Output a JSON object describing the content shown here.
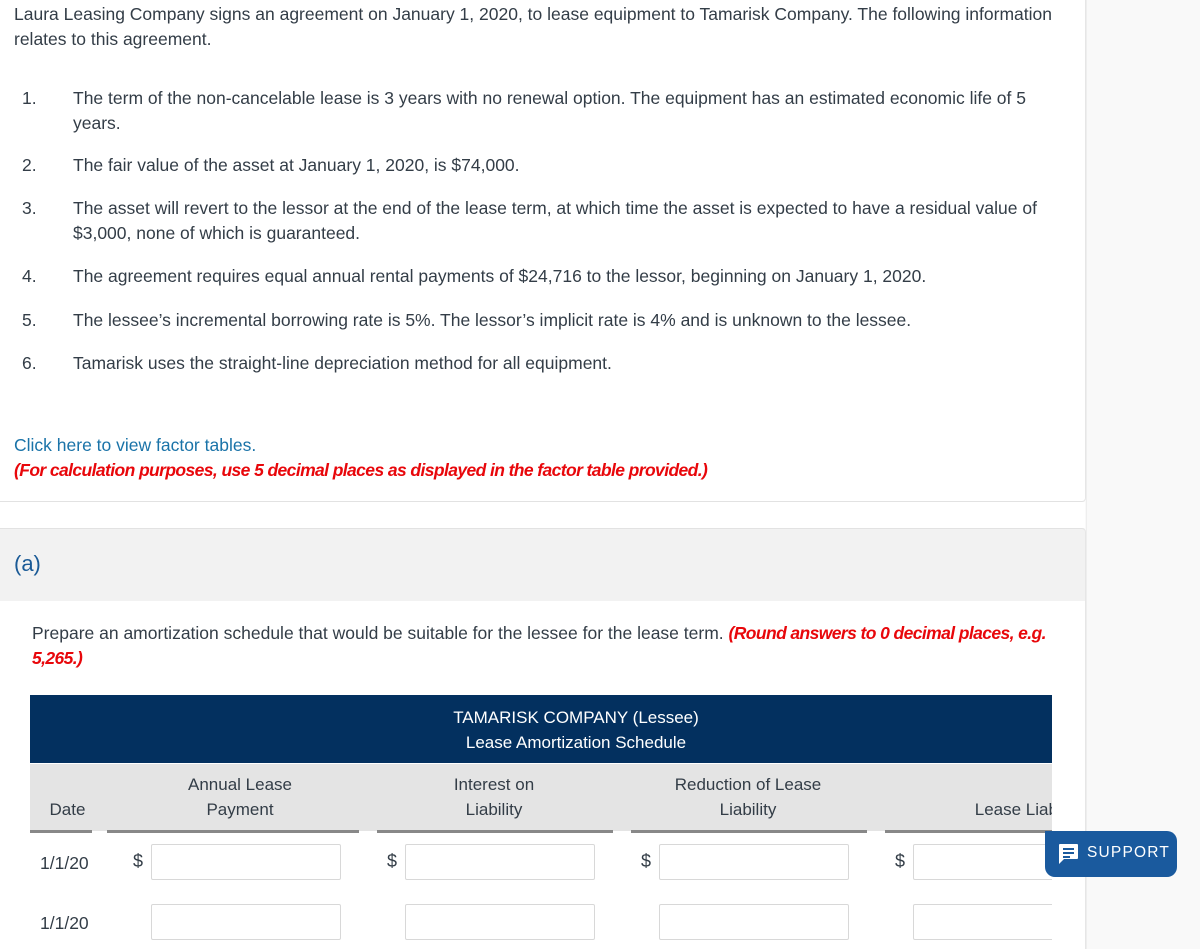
{
  "problem": {
    "intro": "Laura Leasing Company signs an agreement on January 1, 2020, to lease equipment to Tamarisk Company. The following information relates to this agreement.",
    "items": [
      {
        "num": "1.",
        "text": "The term of the non-cancelable lease is 3 years with no renewal option. The equipment has an estimated economic life of 5 years."
      },
      {
        "num": "2.",
        "text": "The fair value of the asset at January 1, 2020, is $74,000."
      },
      {
        "num": "3.",
        "text": "The asset will revert to the lessor at the end of the lease term, at which time the asset is expected to have a residual value of $3,000, none of which is guaranteed."
      },
      {
        "num": "4.",
        "text": "The agreement requires equal annual rental payments of $24,716 to the lessor, beginning on January 1, 2020."
      },
      {
        "num": "5.",
        "text": "The lessee’s incremental borrowing rate is 5%. The lessor’s implicit rate is 4% and is unknown to the lessee."
      },
      {
        "num": "6.",
        "text": "Tamarisk uses the straight-line depreciation method for all equipment."
      }
    ],
    "factor_link": "Click here to view factor tables.",
    "calc_note": "(For calculation purposes, use 5 decimal places as displayed in the factor table provided.)"
  },
  "part_a": {
    "label": "(a)",
    "instruction": "Prepare an amortization schedule that would be suitable for the lessee for the lease term.",
    "rounding_note": "(Round answers to 0 decimal places, e.g. 5,265.)",
    "table": {
      "title_line1": "TAMARISK COMPANY (Lessee)",
      "title_line2": "Lease Amortization Schedule",
      "columns": [
        {
          "line1": "",
          "line2": "Date"
        },
        {
          "line1": "Annual Lease",
          "line2": "Payment"
        },
        {
          "line1": "Interest on",
          "line2": "Liability"
        },
        {
          "line1": "Reduction of Lease",
          "line2": "Liability"
        },
        {
          "line1": "",
          "line2": "Lease Liabilit"
        }
      ],
      "currency_symbol": "$",
      "rows": [
        {
          "date": "1/1/20",
          "payment": "",
          "interest": "",
          "reduction": "",
          "liability": "",
          "show_currency": true
        },
        {
          "date": "1/1/20",
          "payment": "",
          "interest": "",
          "reduction": "",
          "liability": "",
          "show_currency": false
        }
      ]
    }
  },
  "support": {
    "label": "SUPPORT",
    "icon": "chat-bubble-icon",
    "color": "#1a5a9e"
  }
}
